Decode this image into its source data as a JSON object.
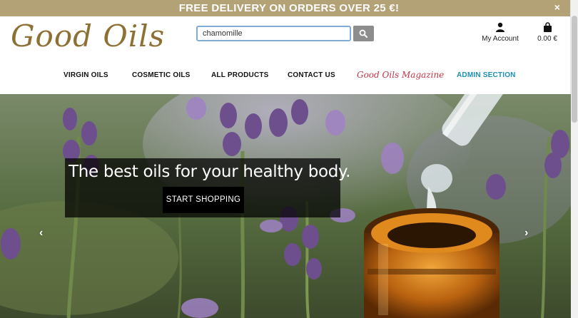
{
  "banner": {
    "text": "FREE DELIVERY ON ORDERS OVER 25 €!",
    "close_icon": "×"
  },
  "logo": {
    "text": "Good Oils"
  },
  "search": {
    "value": "chamomille"
  },
  "account": {
    "label": "My Account",
    "icon": "user-icon"
  },
  "basket": {
    "total": "0.00 €",
    "icon": "shopping-bag-icon"
  },
  "nav": {
    "items": [
      {
        "label": "VIRGIN OILS"
      },
      {
        "label": "COSMETIC OILS"
      },
      {
        "label": "ALL PRODUCTS"
      },
      {
        "label": "CONTACT US"
      },
      {
        "label": "Good Oils Magazine"
      },
      {
        "label": "ADMIN SECTION"
      }
    ]
  },
  "hero": {
    "title": "The best oils for your healthy body.",
    "cta": "START SHOPPING",
    "prev_icon": "‹",
    "next_icon": "›"
  },
  "colors": {
    "brand": "#8c7034",
    "banner": "#b3a275",
    "magazine": "#c3354a",
    "admin": "#1b8fb5"
  }
}
